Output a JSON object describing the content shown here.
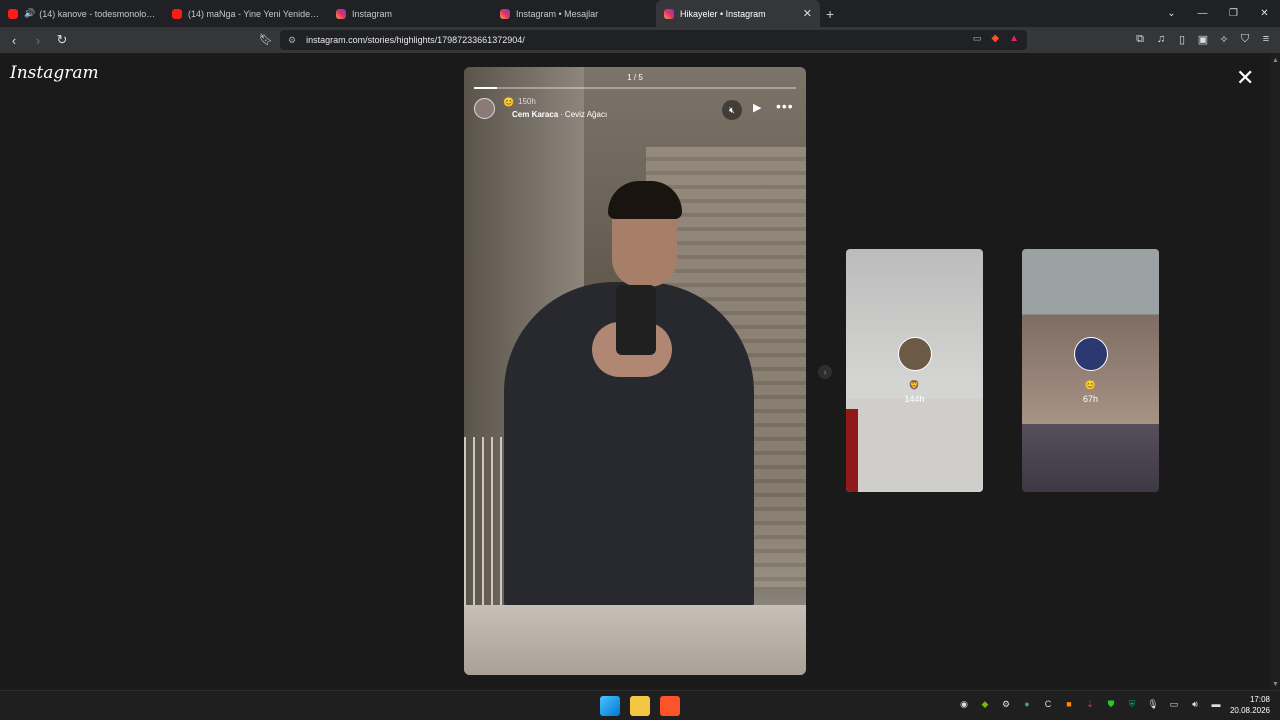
{
  "browser": {
    "tabs": [
      {
        "title": "(14) kanove - todesmonolog (pro",
        "favicon": "youtube",
        "audio": true,
        "active": false
      },
      {
        "title": "(14) maNga - Yine Yeni Yeniden (Yeni",
        "favicon": "youtube",
        "audio": false,
        "active": false
      },
      {
        "title": "Instagram",
        "favicon": "instagram",
        "audio": false,
        "active": false
      },
      {
        "title": "Instagram • Mesajlar",
        "favicon": "instagram",
        "audio": false,
        "active": false
      },
      {
        "title": "Hikayeler • Instagram",
        "favicon": "instagram",
        "audio": false,
        "active": true
      }
    ],
    "new_tab_icon": "plus-icon",
    "url": "instagram.com/stories/highlights/17987233661372904/"
  },
  "page": {
    "logo": "Instagram",
    "close_icon": "close-icon",
    "story": {
      "counter": "1 / 5",
      "progress": 0.07,
      "reaction_emoji": "😊",
      "time_ago": "150h",
      "username": "Cem Karaca",
      "separator": "·",
      "song": "Ceviz Ağacı",
      "mute_icon": "muted-speaker-icon",
      "play_icon": "play-icon",
      "more_icon": "ellipsis-icon"
    },
    "previews": [
      {
        "emoji": "🦁",
        "time_ago": "144h"
      },
      {
        "emoji": "😊",
        "time_ago": "67h"
      }
    ]
  },
  "taskbar": {
    "time": "17:08",
    "date": "20.08.2026"
  },
  "colors": {
    "page_bg": "#1a1a1a",
    "tab_active": "#35363a",
    "accent_brave": "#fb542b"
  }
}
